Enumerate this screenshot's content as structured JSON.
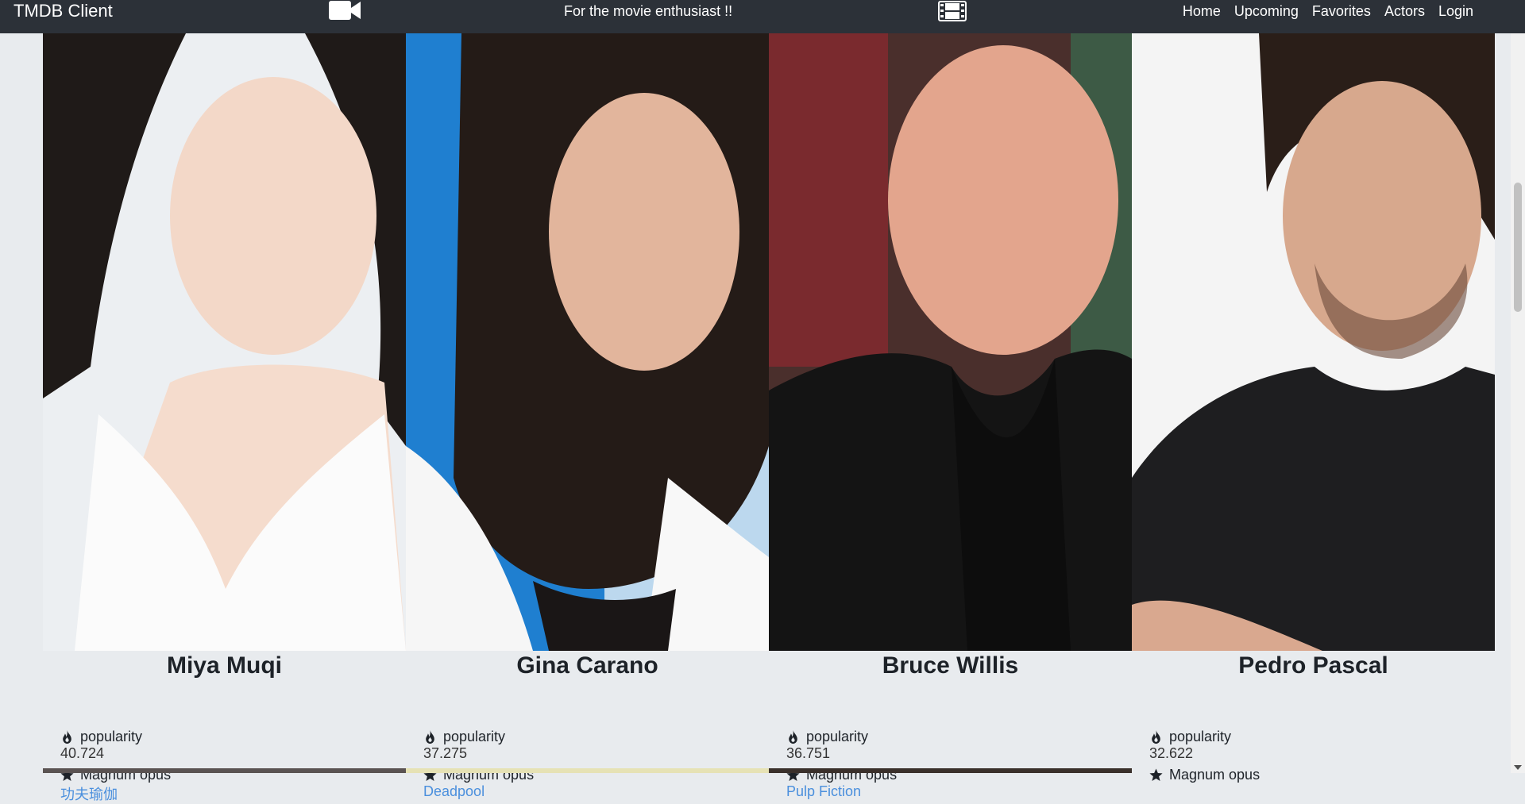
{
  "navbar": {
    "brand": "TMDB Client",
    "tagline": "For the movie enthusiast !!",
    "links": [
      "Home",
      "Upcoming",
      "Favorites",
      "Actors",
      "Login"
    ]
  },
  "labels": {
    "popularity": "popularity",
    "magnum_opus": "Magnum opus"
  },
  "actors": [
    {
      "name": "Miya Muqi",
      "popularity": "40.724",
      "magnum_opus": "功夫瑜伽"
    },
    {
      "name": "Gina Carano",
      "popularity": "37.275",
      "magnum_opus": "Deadpool"
    },
    {
      "name": "Bruce Willis",
      "popularity": "36.751",
      "magnum_opus": "Pulp Fiction"
    },
    {
      "name": "Pedro Pascal",
      "popularity": "32.622",
      "magnum_opus": ""
    }
  ],
  "colors": {
    "navbar_bg": "#2c3138",
    "page_bg": "#e8ebee",
    "link": "#4a8fdd"
  },
  "icons": {
    "brand_left": "video-camera-icon",
    "brand_right": "film-icon",
    "popularity": "flame-icon",
    "magnum_opus": "star-icon"
  }
}
